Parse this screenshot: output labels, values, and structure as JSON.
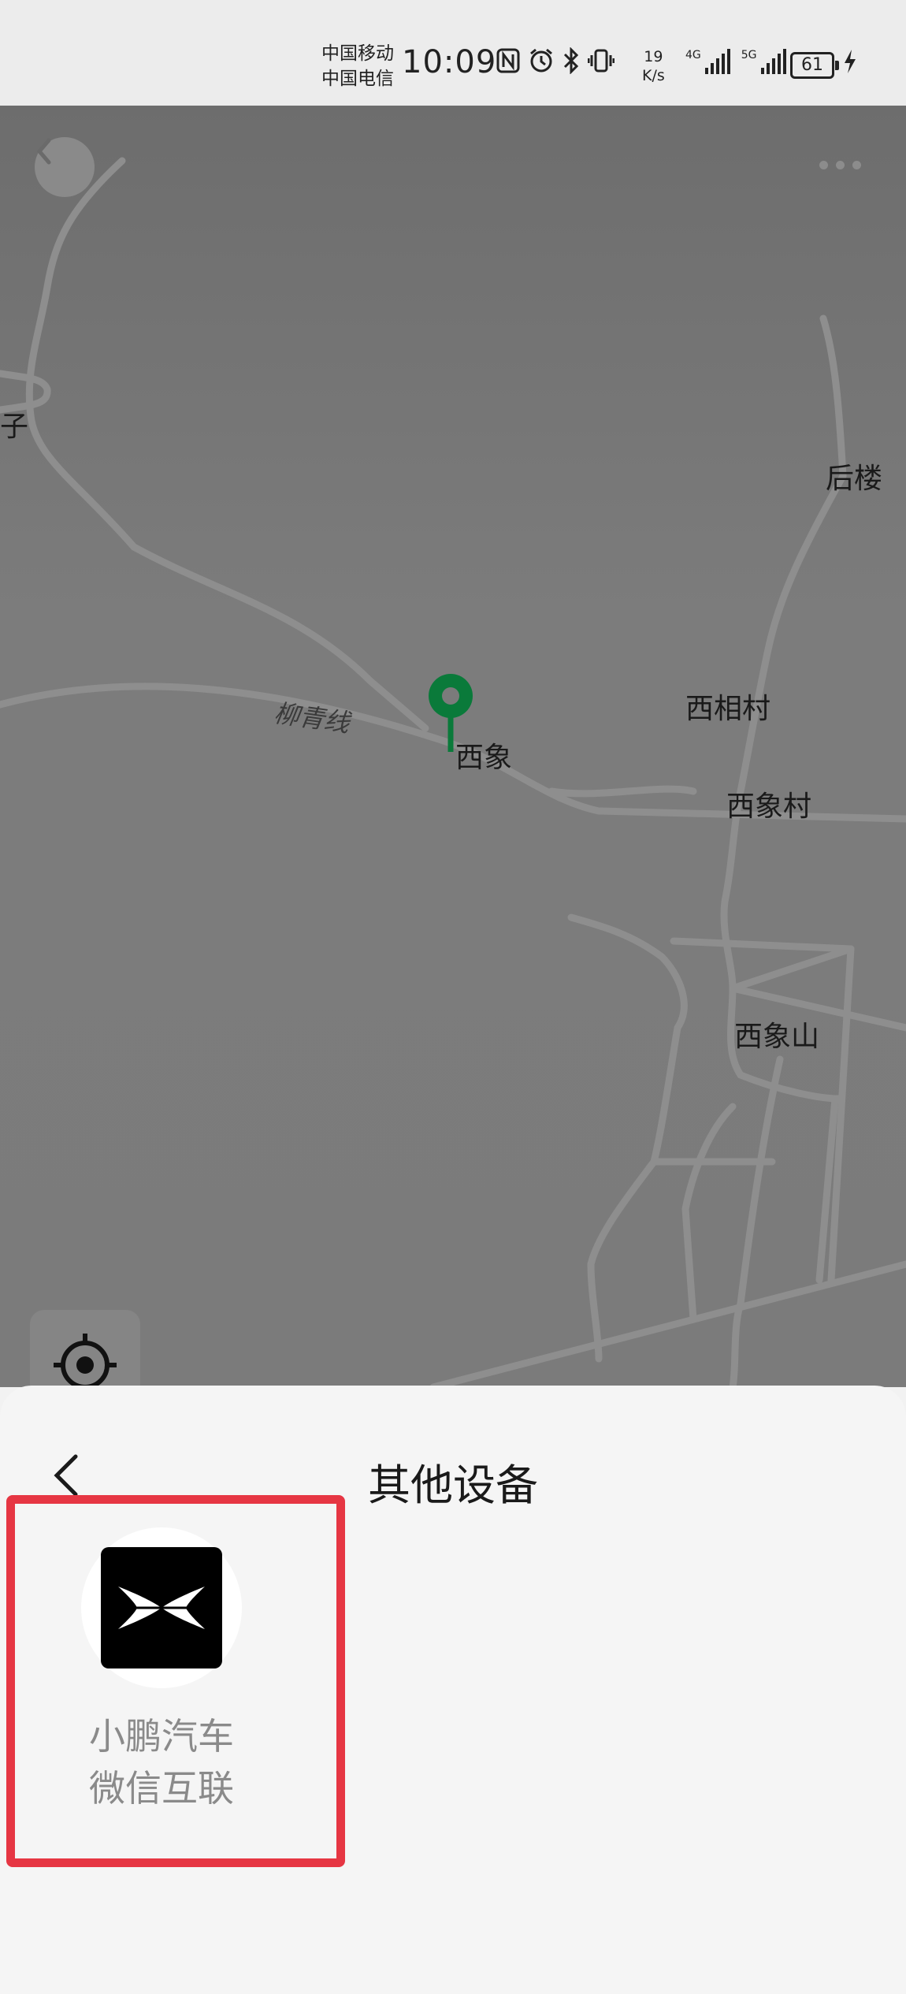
{
  "status_bar": {
    "carrier1": "中国移动",
    "carrier2": "中国电信",
    "time": "10:09",
    "net_speed_value": "19",
    "net_speed_unit": "K/s",
    "sim1_label": "4G",
    "sim2_label": "5G",
    "battery": "61"
  },
  "map": {
    "labels": {
      "zi": "子",
      "houlou": "后楼",
      "xixiangcun_a": "西相村",
      "xixiang": "西象",
      "xixiangcun_b": "西象村",
      "xixiangshan": "西象山"
    },
    "road_name": "柳青线"
  },
  "sheet": {
    "title": "其他设备",
    "device": {
      "name_line1": "小鹏汽车",
      "name_line2": "微信互联"
    }
  },
  "colors": {
    "highlight": "#e63643",
    "pin": "#0a7a3a"
  }
}
